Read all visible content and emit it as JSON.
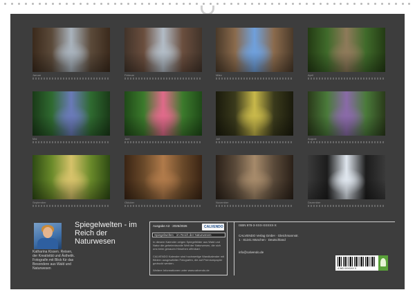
{
  "calendar": {
    "title": "Spiegelwelten - im Reich der Naturwesen",
    "author_text": "Katharina Kissen. Reisen, der Kreativität und Ästhetik. Fotografin mit Blick für das Besondere aus Wald und Naturwesen",
    "photos": [
      {
        "name": "photo-january",
        "caption": "Januar",
        "colors": [
          "#5b4a3a",
          "#a9b3bd",
          "#3b2a1c"
        ]
      },
      {
        "name": "photo-february",
        "caption": "Februar",
        "colors": [
          "#6a4e3e",
          "#b2bcc6",
          "#42342a"
        ]
      },
      {
        "name": "photo-march",
        "caption": "März",
        "colors": [
          "#8a6a4c",
          "#6fa0dc",
          "#4a3a2a"
        ]
      },
      {
        "name": "photo-april",
        "caption": "April",
        "colors": [
          "#3f6a2a",
          "#8e7a5a",
          "#243b14"
        ]
      },
      {
        "name": "photo-may",
        "caption": "Mai",
        "colors": [
          "#2f6a30",
          "#6a7ab8",
          "#1a3a18"
        ]
      },
      {
        "name": "photo-june",
        "caption": "Juni",
        "colors": [
          "#3c7a2c",
          "#e06a8a",
          "#1f4a18"
        ]
      },
      {
        "name": "photo-july",
        "caption": "Juli",
        "colors": [
          "#3a3a1c",
          "#c8b84a",
          "#1a1a0c"
        ]
      },
      {
        "name": "photo-august",
        "caption": "August",
        "colors": [
          "#4a7a3a",
          "#8a6aa8",
          "#2a3a1a"
        ]
      },
      {
        "name": "photo-september",
        "caption": "September",
        "colors": [
          "#6a8a2a",
          "#d6c26a",
          "#2e4a14"
        ]
      },
      {
        "name": "photo-october",
        "caption": "Oktober",
        "colors": [
          "#6a4a2a",
          "#b07a4a",
          "#3a2414"
        ]
      },
      {
        "name": "photo-november",
        "caption": "November",
        "colors": [
          "#5a4a3a",
          "#a68a6a",
          "#2a2018"
        ]
      },
      {
        "name": "photo-december",
        "caption": "Dezember",
        "colors": [
          "#1c1c1c",
          "#dfe6ee",
          "#3a3a3a"
        ]
      }
    ],
    "info": {
      "dimensions": "Ausgabe A3 · 2025/2026",
      "publisher_logo": "CALVENDO",
      "subtitle": "Spiegelwelten - im Reich der Naturwesen",
      "description": "In diesem Kalender zeigen Spiegelbilder aus Wald und Natur die geheimnisvolle Welt der Naturwesen, die sich uns beim genauen Hinsehen offenbart.",
      "publisher_text": "CALVENDO Kalender sind hochwertige Wandkalender mit Bildern ausgewählter Fotografen, die auf Premiumpapier gedruckt werden.",
      "website": "Weitere Informationen unter www.calvendo.de"
    },
    "right": {
      "heading": "ISBN 978-3-XXX-XXXXX-X",
      "address": "CALVENDO Verlag GmbH · Gleichmannstr. 1 · 81241 München · Deutschland",
      "url": "info@calvendo.de",
      "barcode_number": "4 063 XXXXXX X"
    }
  },
  "colors": {
    "background": "#3d3d3d",
    "page": "#ffffff",
    "text": "#f2f2f2"
  }
}
